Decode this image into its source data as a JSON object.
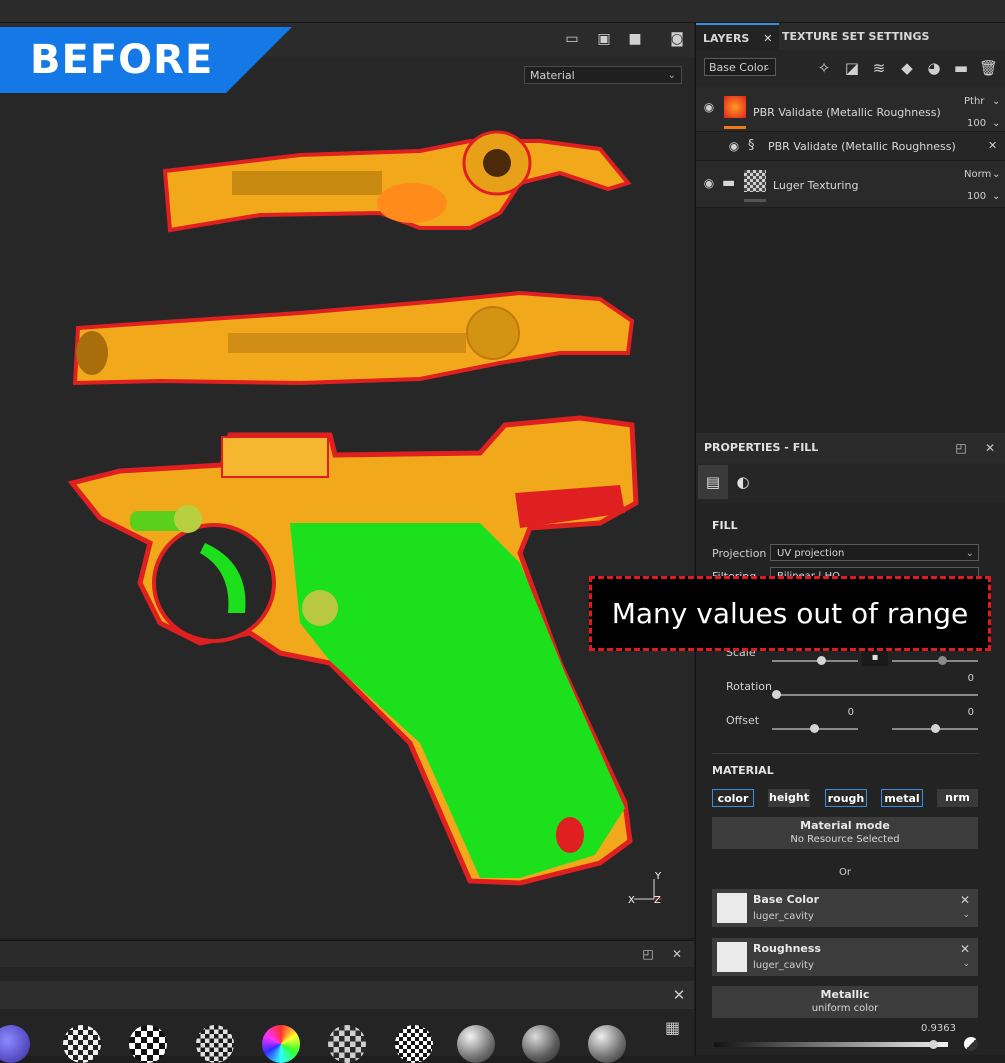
{
  "viewport": {
    "banner": "BEFORE",
    "material_select": "Material",
    "axis": {
      "x": "X",
      "y": "Y",
      "z": "Z"
    }
  },
  "layers_panel": {
    "tabs": {
      "layers": "LAYERS",
      "texture_set": "TEXTURE SET SETTINGS"
    },
    "channel_select": "Base Color",
    "layers": [
      {
        "name": "PBR Validate (Metallic Roughness)",
        "blend": "Pthr",
        "opacity": "100"
      },
      {
        "name": "PBR Validate (Metallic Roughness)"
      },
      {
        "name": "Luger Texturing",
        "blend": "Norm",
        "opacity": "100"
      }
    ]
  },
  "properties": {
    "title": "PROPERTIES - FILL",
    "fill_section": "FILL",
    "projection_label": "Projection",
    "projection_value": "UV projection",
    "filtering_label": "Filtering",
    "filtering_value": "Bilinear | HQ",
    "scale_label": "Scale",
    "rotation_label": "Rotation",
    "rotation_value": "0",
    "offset_label": "Offset",
    "offset_u": "0",
    "offset_v": "0",
    "material_section": "MATERIAL",
    "channels": [
      "color",
      "height",
      "rough",
      "metal",
      "nrm"
    ],
    "material_mode_title": "Material mode",
    "material_mode_value": "No Resource Selected",
    "or_text": "Or",
    "slots": [
      {
        "title": "Base Color",
        "resource": "luger_cavity"
      },
      {
        "title": "Roughness",
        "resource": "luger_cavity"
      }
    ],
    "metallic_title": "Metallic",
    "metallic_sub": "uniform color",
    "metallic_value": "0.9363",
    "metallic_level": 0.9363
  },
  "callout": "Many values out of range",
  "colors": {
    "accent": "#3a8dde",
    "banner": "#1479e6",
    "callout_border": "#e01b1b",
    "gun_orange": "#f2a81b",
    "gun_green": "#1de01d",
    "gun_red": "#e02020"
  }
}
